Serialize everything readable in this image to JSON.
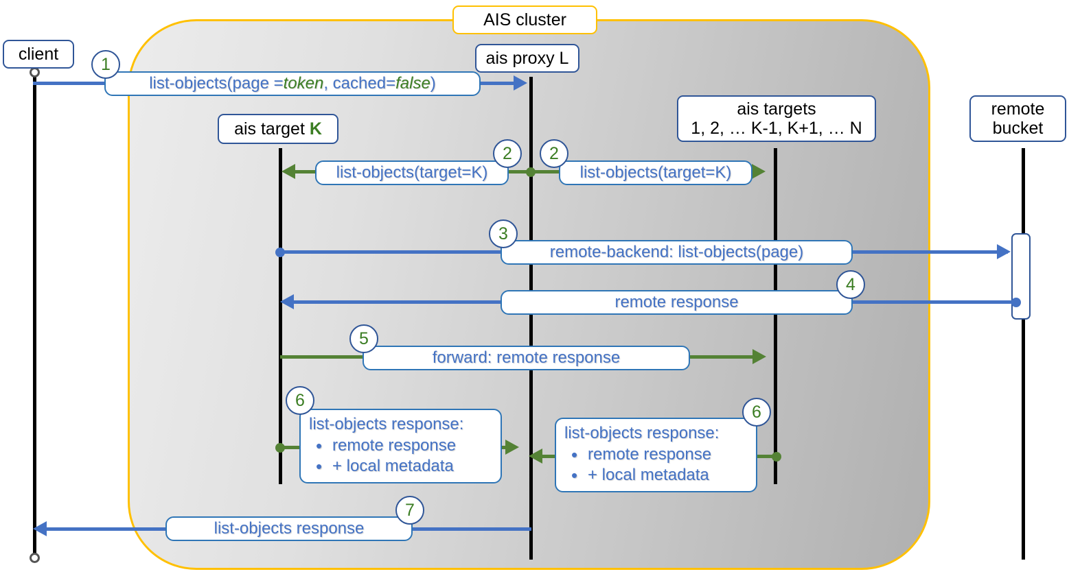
{
  "diagram": {
    "title": "AIS cluster",
    "type": "sequence-diagram"
  },
  "participants": {
    "client": {
      "label": "client"
    },
    "proxy": {
      "label": "ais proxy L"
    },
    "target_k": {
      "label_prefix": "ais target ",
      "label_accent": "K"
    },
    "targets": {
      "line1": "ais targets",
      "line2": "1, 2, … K-1, K+1, … N"
    },
    "remote": {
      "line1": "remote",
      "line2": "bucket"
    }
  },
  "messages": {
    "m1": {
      "step": "1",
      "part_a": "list-objects(page = ",
      "part_token": "token",
      "part_b": ", cached=",
      "part_false": "false",
      "part_c": ")"
    },
    "m2a": {
      "step": "2",
      "text": "list-objects(target=K)"
    },
    "m2b": {
      "step": "2",
      "text": "list-objects(target=K)"
    },
    "m3": {
      "step": "3",
      "text": "remote-backend: list-objects(page)"
    },
    "m4": {
      "step": "4",
      "text": "remote response"
    },
    "m5": {
      "step": "5",
      "text": "forward: remote response"
    },
    "m6a": {
      "step": "6",
      "title": "list-objects response:",
      "bullets": [
        "remote response",
        "+ local metadata"
      ]
    },
    "m6b": {
      "step": "6",
      "title": "list-objects response:",
      "bullets": [
        "remote response",
        "+ local metadata"
      ]
    },
    "m7": {
      "step": "7",
      "text": "list-objects response"
    }
  },
  "colors": {
    "cluster_border": "#FFC000",
    "box_border": "#2F5597",
    "msg_border": "#2E75B6",
    "msg_text": "#4472C4",
    "accent_green": "#3B7D23",
    "arrow_blue": "#4472C4",
    "arrow_green": "#548235",
    "lifeline": "#000000"
  }
}
